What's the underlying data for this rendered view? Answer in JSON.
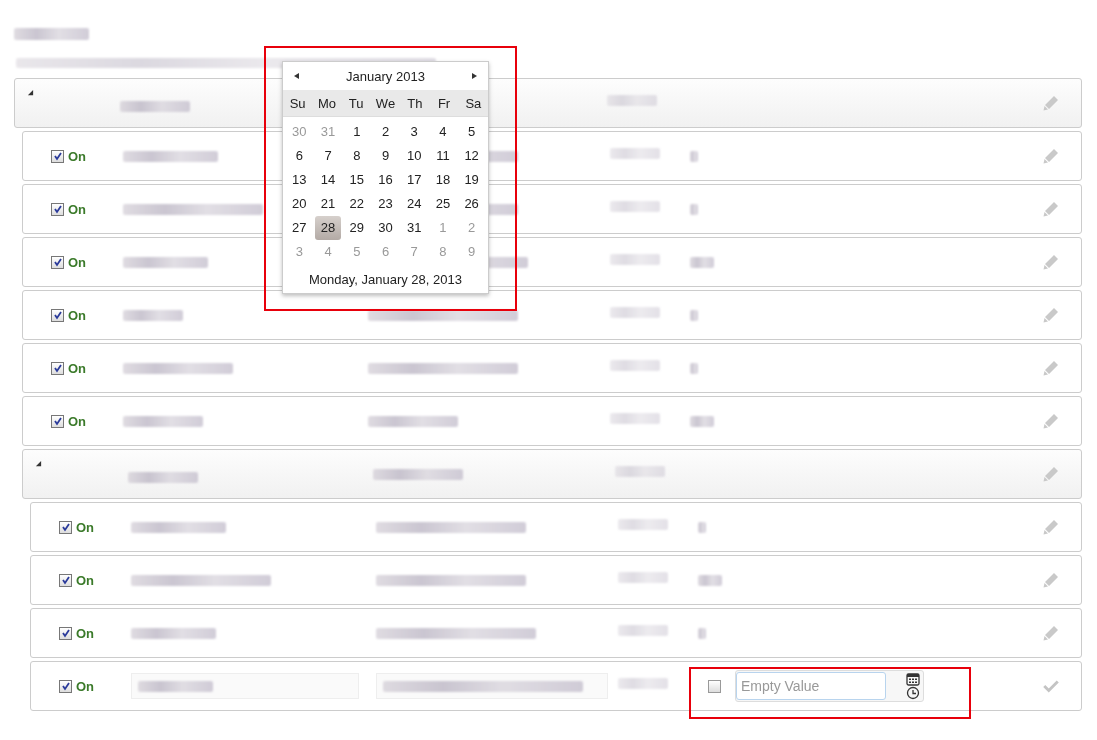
{
  "tree": {
    "kind": "group",
    "expanded": true,
    "children": [
      {
        "kind": "row",
        "enabled": true,
        "label": "On"
      },
      {
        "kind": "row",
        "enabled": true,
        "label": "On"
      },
      {
        "kind": "row",
        "enabled": true,
        "label": "On"
      },
      {
        "kind": "row",
        "enabled": true,
        "label": "On"
      },
      {
        "kind": "row",
        "enabled": true,
        "label": "On"
      },
      {
        "kind": "row",
        "enabled": true,
        "label": "On"
      },
      {
        "kind": "group",
        "expanded": true,
        "children": [
          {
            "kind": "row",
            "enabled": true,
            "label": "On"
          },
          {
            "kind": "row",
            "enabled": true,
            "label": "On"
          },
          {
            "kind": "row",
            "enabled": true,
            "label": "On"
          },
          {
            "kind": "edit-row",
            "enabled": true,
            "label": "On",
            "value_set": false,
            "value": {
              "placeholder": "Empty Value"
            }
          }
        ]
      }
    ]
  },
  "datepicker": {
    "month": "January 2013",
    "weekdays": [
      "Su",
      "Mo",
      "Tu",
      "We",
      "Th",
      "Fr",
      "Sa"
    ],
    "weeks": [
      [
        {
          "day": "30",
          "outside": true,
          "selected": false
        },
        {
          "day": "31",
          "outside": true,
          "selected": false
        },
        {
          "day": "1",
          "outside": false,
          "selected": false
        },
        {
          "day": "2",
          "outside": false,
          "selected": false
        },
        {
          "day": "3",
          "outside": false,
          "selected": false
        },
        {
          "day": "4",
          "outside": false,
          "selected": false
        },
        {
          "day": "5",
          "outside": false,
          "selected": false
        }
      ],
      [
        {
          "day": "6",
          "outside": false,
          "selected": false
        },
        {
          "day": "7",
          "outside": false,
          "selected": false
        },
        {
          "day": "8",
          "outside": false,
          "selected": false
        },
        {
          "day": "9",
          "outside": false,
          "selected": false
        },
        {
          "day": "10",
          "outside": false,
          "selected": false
        },
        {
          "day": "11",
          "outside": false,
          "selected": false
        },
        {
          "day": "12",
          "outside": false,
          "selected": false
        }
      ],
      [
        {
          "day": "13",
          "outside": false,
          "selected": false
        },
        {
          "day": "14",
          "outside": false,
          "selected": false
        },
        {
          "day": "15",
          "outside": false,
          "selected": false
        },
        {
          "day": "16",
          "outside": false,
          "selected": false
        },
        {
          "day": "17",
          "outside": false,
          "selected": false
        },
        {
          "day": "18",
          "outside": false,
          "selected": false
        },
        {
          "day": "19",
          "outside": false,
          "selected": false
        }
      ],
      [
        {
          "day": "20",
          "outside": false,
          "selected": false
        },
        {
          "day": "21",
          "outside": false,
          "selected": false
        },
        {
          "day": "22",
          "outside": false,
          "selected": false
        },
        {
          "day": "23",
          "outside": false,
          "selected": false
        },
        {
          "day": "24",
          "outside": false,
          "selected": false
        },
        {
          "day": "25",
          "outside": false,
          "selected": false
        },
        {
          "day": "26",
          "outside": false,
          "selected": false
        }
      ],
      [
        {
          "day": "27",
          "outside": false,
          "selected": false
        },
        {
          "day": "28",
          "outside": false,
          "selected": true
        },
        {
          "day": "29",
          "outside": false,
          "selected": false
        },
        {
          "day": "30",
          "outside": false,
          "selected": false
        },
        {
          "day": "31",
          "outside": false,
          "selected": false
        },
        {
          "day": "1",
          "outside": true,
          "selected": false
        },
        {
          "day": "2",
          "outside": true,
          "selected": false
        }
      ],
      [
        {
          "day": "3",
          "outside": true,
          "selected": false
        },
        {
          "day": "4",
          "outside": true,
          "selected": false
        },
        {
          "day": "5",
          "outside": true,
          "selected": false
        },
        {
          "day": "6",
          "outside": true,
          "selected": false
        },
        {
          "day": "7",
          "outside": true,
          "selected": false
        },
        {
          "day": "8",
          "outside": true,
          "selected": false
        },
        {
          "day": "9",
          "outside": true,
          "selected": false
        }
      ]
    ],
    "footer": "Monday, January 28, 2013"
  }
}
